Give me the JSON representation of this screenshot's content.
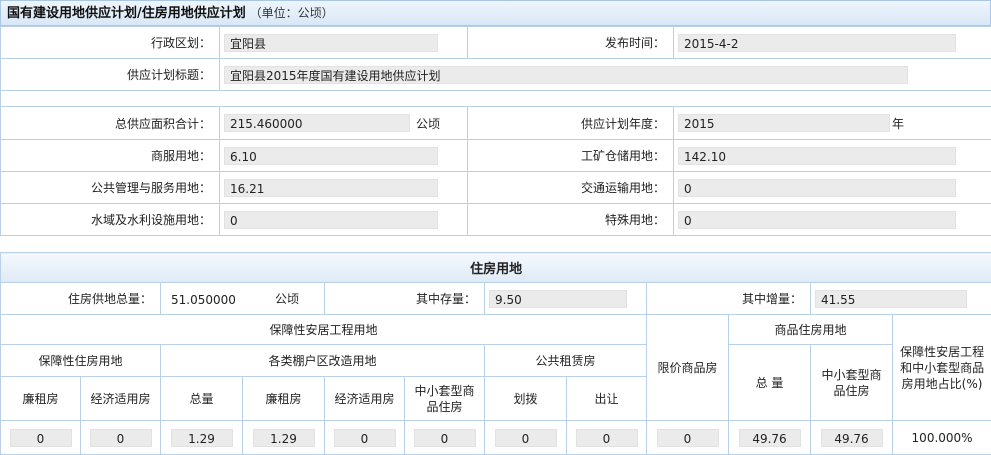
{
  "header": {
    "title": "国有建设用地供应计划/住房用地供应计划",
    "unit": "（单位：公顷）"
  },
  "basic": {
    "region_label": "行政区划：",
    "region_value": "宜阳县",
    "publish_label": "发布时间：",
    "publish_value": "2015-4-2",
    "plan_title_label": "供应计划标题：",
    "plan_title_value": "宜阳县2015年度国有建设用地供应计划"
  },
  "totals": {
    "total_label": "总供应面积合计：",
    "total_value": "215.460000",
    "total_unit": "公顷",
    "year_label": "供应计划年度：",
    "year_value": "2015",
    "year_unit": "年",
    "commercial_label": "商服用地：",
    "commercial_value": "6.10",
    "industrial_label": "工矿仓储用地：",
    "industrial_value": "142.10",
    "public_label": "公共管理与服务用地：",
    "public_value": "16.21",
    "transport_label": "交通运输用地：",
    "transport_value": "0",
    "water_label": "水域及水利设施用地：",
    "water_value": "0",
    "special_label": "特殊用地：",
    "special_value": "0"
  },
  "housing": {
    "section_title": "住房用地",
    "total_label": "住房供地总量：",
    "total_value": "51.050000",
    "total_unit": "公顷",
    "stock_label": "其中存量：",
    "stock_value": "9.50",
    "increase_label": "其中增量：",
    "increase_value": "41.55",
    "headers": {
      "affordable": "保障性安居工程用地",
      "commercial_housing": "商品住房用地",
      "ratio": "保障性安居工程和中小套型商品房用地占比(%)",
      "guaranteed": "保障性住房用地",
      "shanty": "各类棚户区改造用地",
      "public_rental": "公共租赁房",
      "price_limited": "限价商品房",
      "low_rent": "廉租房",
      "economic": "经济适用房",
      "shanty_total": "总量",
      "shanty_low_rent": "廉租房",
      "shanty_economic": "经济适用房",
      "shanty_small": "中小套型商品住房",
      "allocation": "划拨",
      "transfer": "出让",
      "commercial_total": "总 量",
      "commercial_small": "中小套型商品住房"
    },
    "values": {
      "low_rent": "0",
      "economic": "0",
      "shanty_total": "1.29",
      "shanty_low_rent": "1.29",
      "shanty_economic": "0",
      "shanty_small": "0",
      "allocation": "0",
      "transfer": "0",
      "price_limited": "0",
      "commercial_total": "49.76",
      "commercial_small": "49.76",
      "ratio": "100.000%"
    }
  }
}
